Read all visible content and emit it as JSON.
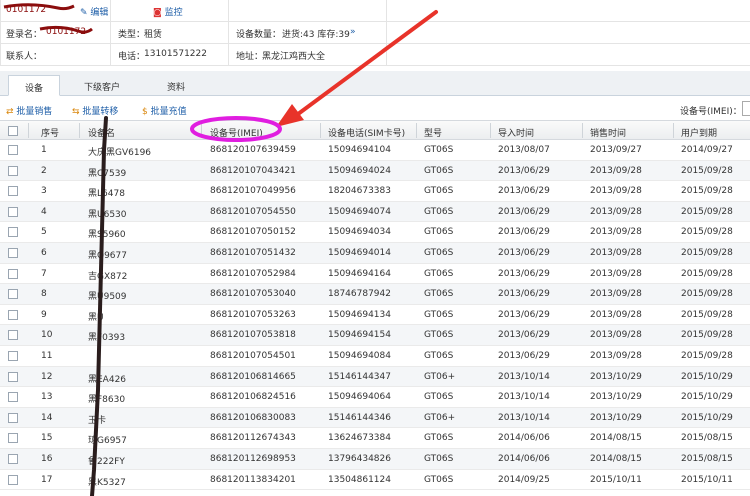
{
  "info": {
    "account_id": "0101172",
    "edit_label": "编辑",
    "monitor_label": "监控",
    "login_label": "登录名：",
    "login_value": "0101172",
    "type_label": "类型：",
    "type_value": "租赁",
    "device_count_label": "设备数量：",
    "device_count_value": "进货:43 库存:39",
    "more_glyph": "»",
    "contact_label": "联系人：",
    "contact_value": "",
    "phone_label": "电话：",
    "phone_value": "13101571222",
    "address_label": "地址：",
    "address_value": "黑龙江鸡西大全"
  },
  "tabs": [
    {
      "label": "设备",
      "active": true
    },
    {
      "label": "下级客户",
      "active": false
    },
    {
      "label": "资料",
      "active": false
    }
  ],
  "toolbar": {
    "batch_sale": "批量销售",
    "batch_transfer": "批量转移",
    "batch_recharge": "批量充值",
    "search_label": "设备号(IMEI)："
  },
  "table": {
    "headers": [
      "序号",
      "设备名",
      "设备号(IMEI)",
      "设备电话(SIM卡号)",
      "型号",
      "导入时间",
      "销售时间",
      "用户到期"
    ],
    "rows": [
      [
        "1",
        "大庆黑GV6196",
        "868120107639459",
        "15094694104",
        "GT06S",
        "2013/08/07",
        "2013/09/27",
        "2014/09/27"
      ],
      [
        "2",
        "黑C7539",
        "868120107043421",
        "15094694024",
        "GT06S",
        "2013/06/29",
        "2013/09/28",
        "2015/09/28"
      ],
      [
        "3",
        "黑L6478",
        "868120107049956",
        "18204673383",
        "GT06S",
        "2013/06/29",
        "2013/09/28",
        "2015/09/28"
      ],
      [
        "4",
        "黑U6530",
        "868120107054550",
        "15094694074",
        "GT06S",
        "2013/06/29",
        "2013/09/28",
        "2015/09/28"
      ],
      [
        "5",
        "黑S5960",
        "868120107050152",
        "15094694034",
        "GT06S",
        "2013/06/29",
        "2013/09/28",
        "2015/09/28"
      ],
      [
        "6",
        "黑Q9677",
        "868120107051432",
        "15094694014",
        "GT06S",
        "2013/06/29",
        "2013/09/28",
        "2015/09/28"
      ],
      [
        "7",
        "吉GX872",
        "868120107052984",
        "15094694164",
        "GT06S",
        "2013/06/29",
        "2013/09/28",
        "2015/09/28"
      ],
      [
        "8",
        "黑U9509",
        "868120107053040",
        "18746787942",
        "GT06S",
        "2013/06/29",
        "2013/09/28",
        "2015/09/28"
      ],
      [
        "9",
        "黑U",
        "868120107053263",
        "15094694134",
        "GT06S",
        "2013/06/29",
        "2013/09/28",
        "2015/09/28"
      ],
      [
        "10",
        "黑F0393",
        "868120107053818",
        "15094694154",
        "GT06S",
        "2013/06/29",
        "2013/09/28",
        "2015/09/28"
      ],
      [
        "11",
        "",
        "868120107054501",
        "15094694084",
        "GT06S",
        "2013/06/29",
        "2013/09/28",
        "2015/09/28"
      ],
      [
        "12",
        "黑EA426",
        "868120106814665",
        "15146144347",
        "GT06+",
        "2013/10/14",
        "2013/10/29",
        "2015/10/29"
      ],
      [
        "13",
        "黑F8630",
        "868120106824516",
        "15094694064",
        "GT06S",
        "2013/10/14",
        "2013/10/29",
        "2015/10/29"
      ],
      [
        "14",
        "玉卡",
        "868120106830083",
        "15146144346",
        "GT06+",
        "2013/10/14",
        "2013/10/29",
        "2015/10/29"
      ],
      [
        "15",
        "琼G6957",
        "868120112674343",
        "13624673384",
        "GT06S",
        "2014/06/06",
        "2014/08/15",
        "2015/08/15"
      ],
      [
        "16",
        "鲁222FY",
        "868120112698953",
        "13796434826",
        "GT06S",
        "2014/06/06",
        "2014/08/15",
        "2015/08/15"
      ],
      [
        "17",
        "黑K5327",
        "868120113834201",
        "13504861124",
        "GT06S",
        "2014/09/25",
        "2015/10/11",
        "2015/10/11"
      ]
    ]
  },
  "colors": {
    "accent_link": "#1f5fa8",
    "annotation_magenta": "#e01ee0",
    "annotation_red": "#e8332a",
    "redaction": "#8b0d0d",
    "toolbar_icon": "#d9860b"
  },
  "icons": {
    "edit": "pencil-icon",
    "monitor": "camera-icon",
    "batch_sale": "swap-icon",
    "batch_transfer": "transfer-icon",
    "batch_recharge": "dollar-icon"
  }
}
